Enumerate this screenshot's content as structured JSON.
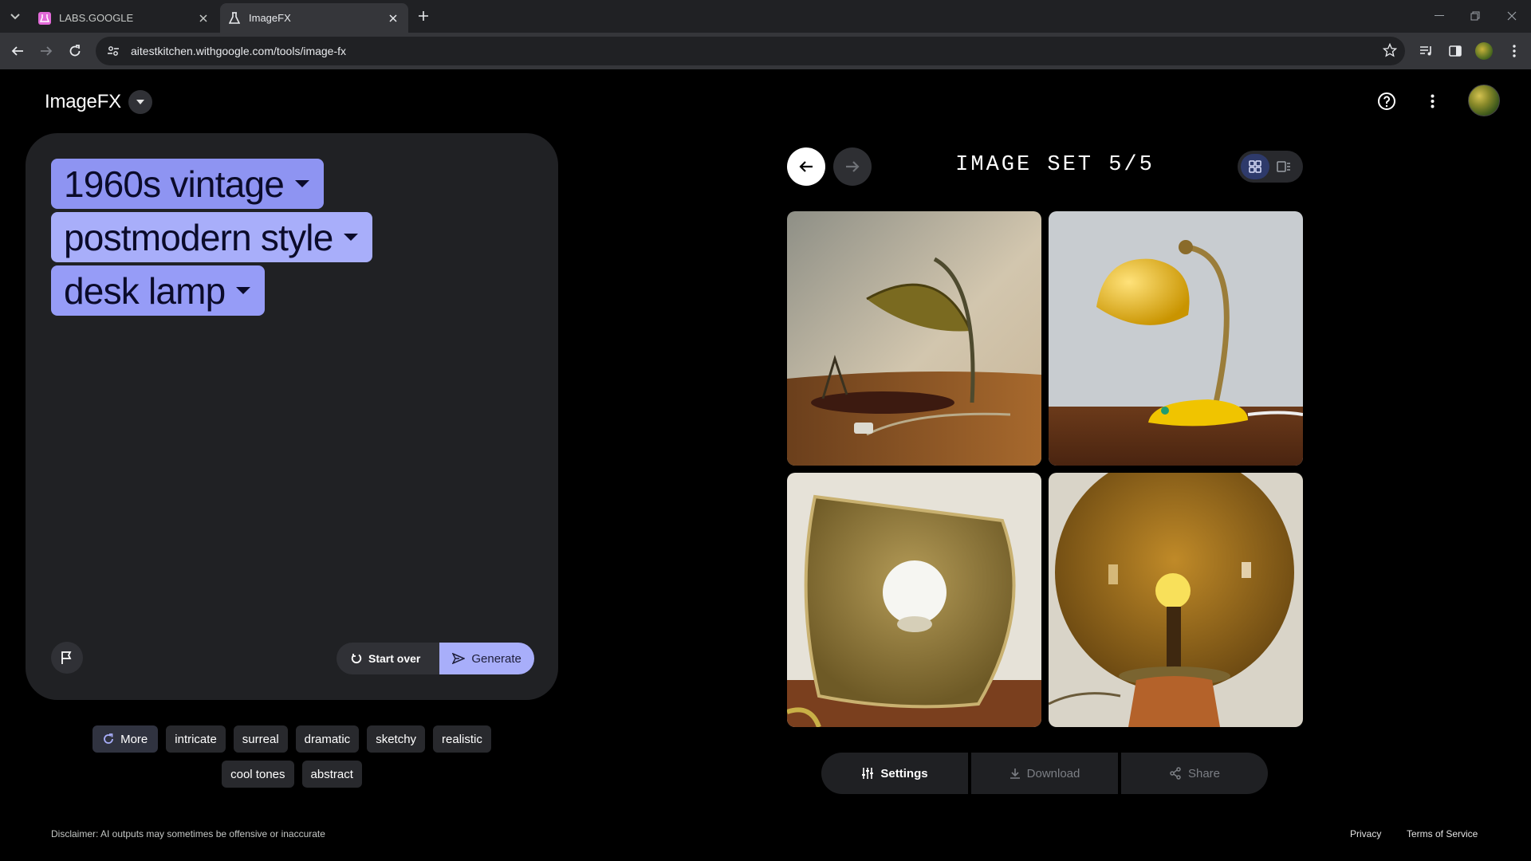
{
  "browser": {
    "tabs": [
      {
        "title": "LABS.GOOGLE",
        "active": false
      },
      {
        "title": "ImageFX",
        "active": true
      }
    ],
    "url": "aitestkitchen.withgoogle.com/tools/image-fx"
  },
  "app": {
    "name": "ImageFX",
    "prompt_chips": [
      "1960s vintage",
      "postmodern style",
      "desk lamp"
    ],
    "actions": {
      "start_over": "Start over",
      "generate": "Generate"
    },
    "suggestions_row1": [
      "More",
      "intricate",
      "surreal",
      "dramatic",
      "sketchy",
      "realistic"
    ],
    "suggestions_row2": [
      "cool tones",
      "abstract"
    ],
    "image_set_label": "IMAGE SET 5/5",
    "image_tiles": [
      {
        "label": "olive dome desk lamp"
      },
      {
        "label": "yellow dome desk lamp"
      },
      {
        "label": "brass triangular lamp"
      },
      {
        "label": "amber globe lamp"
      }
    ],
    "bottom_actions": {
      "settings": "Settings",
      "download": "Download",
      "share": "Share"
    },
    "disclaimer": "Disclaimer: AI outputs may sometimes be offensive or inaccurate",
    "footer": {
      "privacy": "Privacy",
      "terms": "Terms of Service"
    }
  },
  "colors": {
    "chip_primary": "#8e94f2",
    "chip_secondary": "#a8aefa",
    "panel": "#202124",
    "background": "#000000"
  }
}
